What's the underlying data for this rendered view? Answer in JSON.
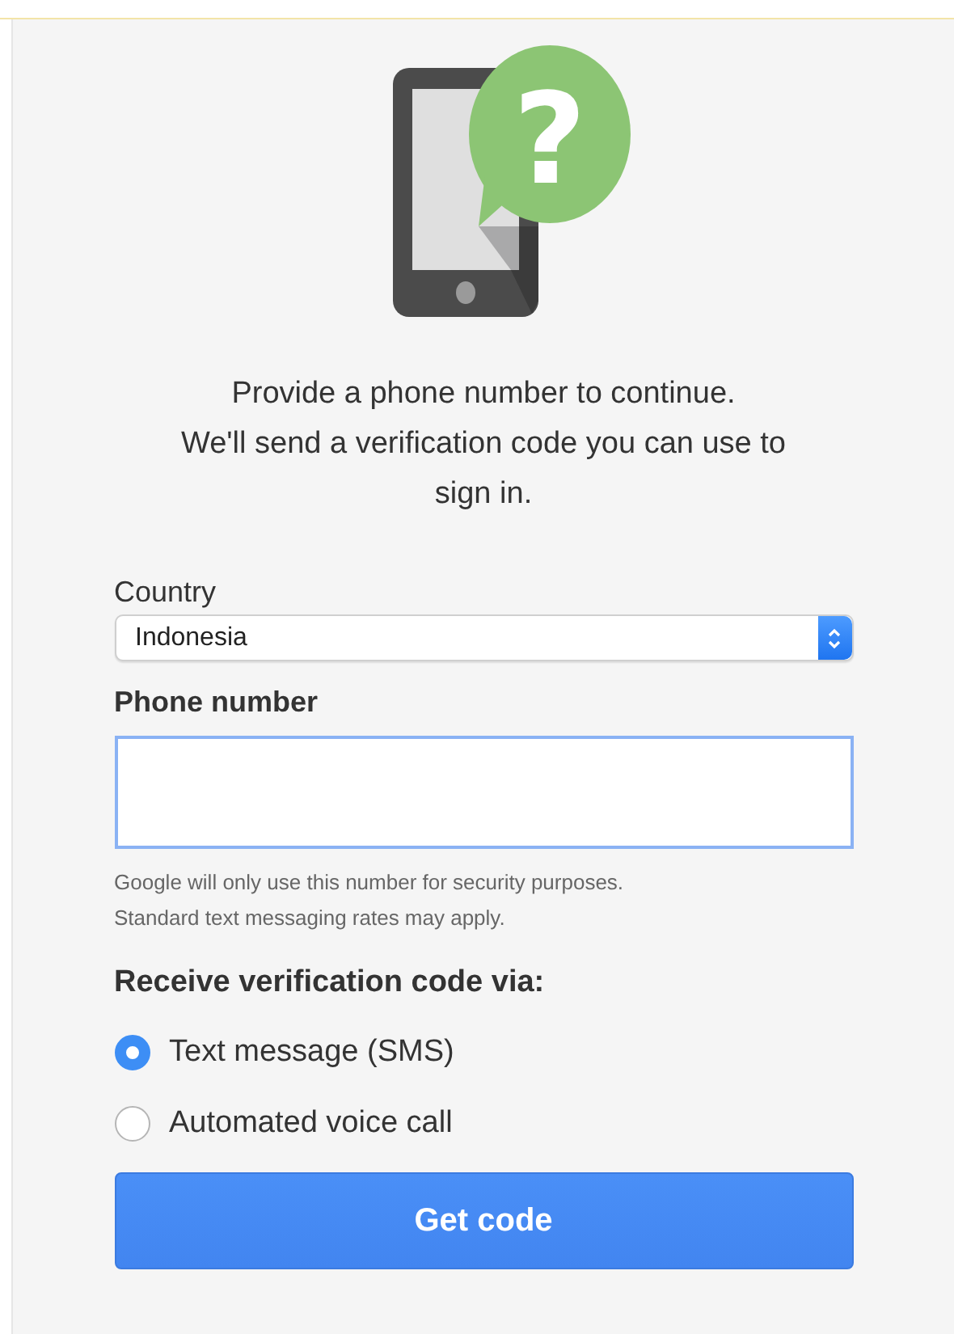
{
  "icon_glyph": "?",
  "intro": [
    "Provide a phone number to continue.",
    "We'll send a verification code you can use to sign in."
  ],
  "country": {
    "label": "Country",
    "value": "Indonesia"
  },
  "phone": {
    "label": "Phone number"
  },
  "help": [
    "Google will only use this number for security purposes.",
    "Standard text messaging rates may apply."
  ],
  "method": {
    "heading": "Receive verification code via:",
    "options": [
      {
        "label": "Text message (SMS)",
        "selected": true
      },
      {
        "label": "Automated voice call",
        "selected": false
      }
    ]
  },
  "button": "Get code"
}
